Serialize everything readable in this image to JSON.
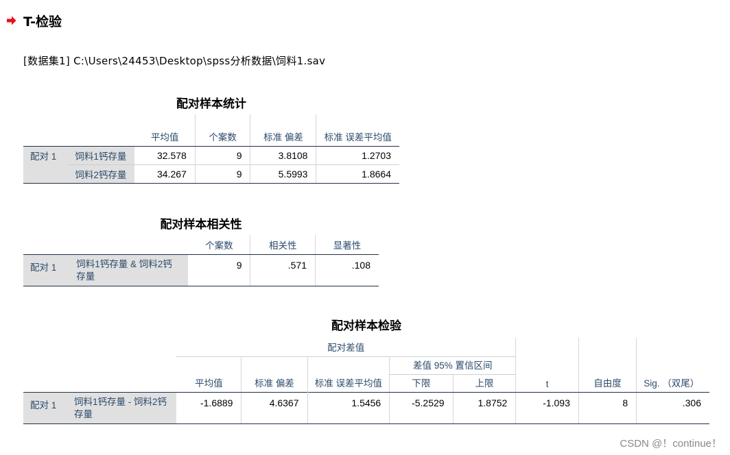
{
  "heading": {
    "title": "T-检验"
  },
  "dataset_line": "[数据集1] C:\\Users\\24453\\Desktop\\spss分析数据\\饲料1.sav",
  "paired_stats": {
    "title": "配对样本统计",
    "headers": [
      "平均值",
      "个案数",
      "标准 偏差",
      "标准 误差平均值"
    ],
    "pair_label": "配对 1",
    "rows": [
      {
        "var": "饲料1钙存量",
        "mean": "32.578",
        "n": "9",
        "sd": "3.8108",
        "se": "1.2703"
      },
      {
        "var": "饲料2钙存量",
        "mean": "34.267",
        "n": "9",
        "sd": "5.5993",
        "se": "1.8664"
      }
    ]
  },
  "paired_corr": {
    "title": "配对样本相关性",
    "headers": [
      "个案数",
      "相关性",
      "显著性"
    ],
    "pair_label": "配对 1",
    "row": {
      "var": "饲料1钙存量 & 饲料2钙存量",
      "n": "9",
      "corr": ".571",
      "sig": ".108"
    }
  },
  "paired_test": {
    "title": "配对样本检验",
    "group_header": "配对差值",
    "ci_header": "差值 95% 置信区间",
    "headers": {
      "mean": "平均值",
      "sd": "标准 偏差",
      "se": "标准 误差平均值",
      "lower": "下限",
      "upper": "上限",
      "t": "t",
      "df": "自由度",
      "sig": "Sig. （双尾）"
    },
    "pair_label": "配对 1",
    "row": {
      "var": "饲料1钙存量 - 饲料2钙存量",
      "mean": "-1.6889",
      "sd": "4.6367",
      "se": "1.5456",
      "lower": "-5.2529",
      "upper": "1.8752",
      "t": "-1.093",
      "df": "8",
      "sig": ".306"
    }
  },
  "watermark": "CSDN @！continue！",
  "colors": {
    "arrow": "#e8101a",
    "header_text": "#2c4a6c",
    "label_bg": "#e0e0e0"
  }
}
